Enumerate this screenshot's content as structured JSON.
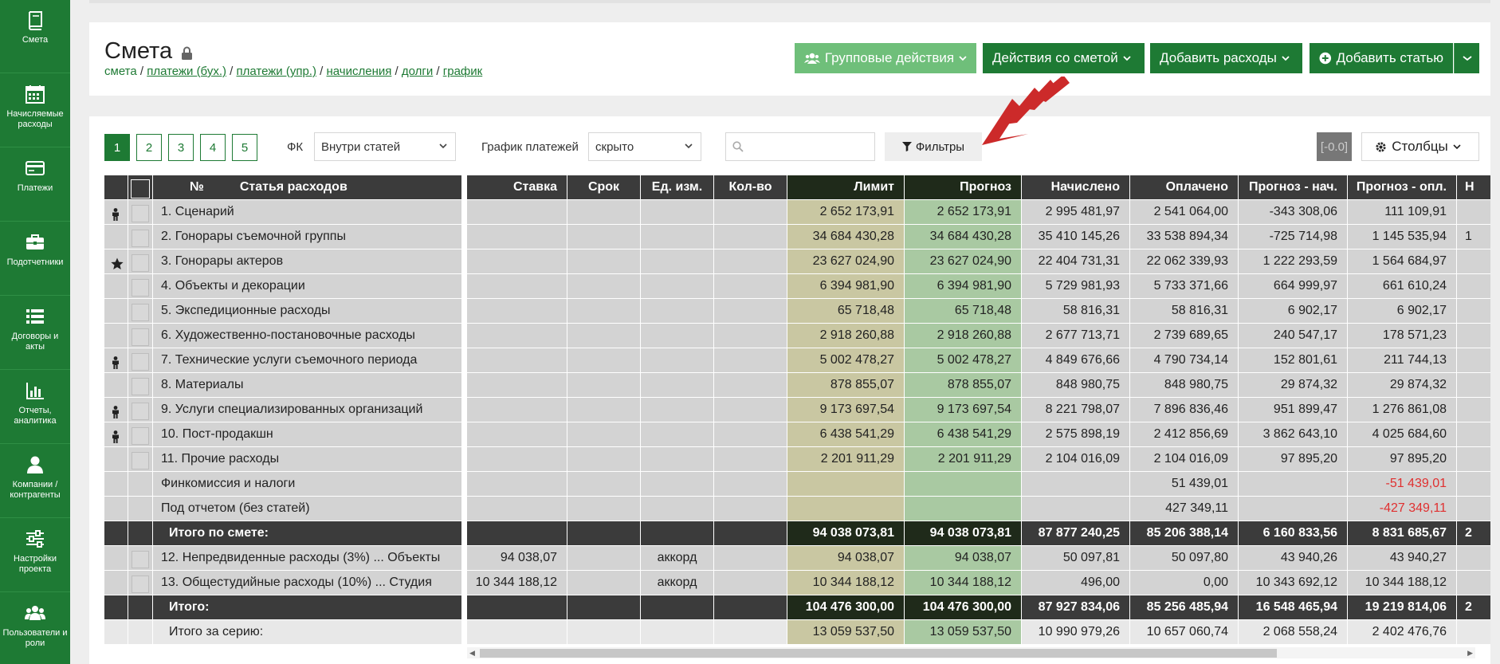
{
  "sidebar": {
    "items": [
      {
        "label": "Смета",
        "icon": "book-icon"
      },
      {
        "label": "Начисляемые расходы",
        "icon": "calendar-icon"
      },
      {
        "label": "Платежи",
        "icon": "credit-card-icon"
      },
      {
        "label": "Подотчетники",
        "icon": "briefcase-icon"
      },
      {
        "label": "Договоры и акты",
        "icon": "list-icon"
      },
      {
        "label": "Отчеты, аналитика",
        "icon": "bar-chart-icon"
      },
      {
        "label": "Компании / контрагенты",
        "icon": "user-icon"
      },
      {
        "label": "Настройки проекта",
        "icon": "sliders-icon"
      },
      {
        "label": "Пользователи и роли",
        "icon": "users-icon"
      }
    ]
  },
  "header": {
    "title": "Смета",
    "breadcrumb": {
      "current": "смета",
      "links": [
        "платежи (бух.)",
        "платежи (упр.)",
        "начисления",
        "долги",
        "график"
      ],
      "separator": " / "
    },
    "buttons": {
      "group_actions": "Групповые действия",
      "estimate_actions": "Действия со сметой",
      "add_expenses": "Добавить расходы",
      "add_item": "Добавить статью"
    }
  },
  "toolbar": {
    "pages": [
      "1",
      "2",
      "3",
      "4",
      "5"
    ],
    "fk_label": "ФК",
    "fk_value": "Внутри статей",
    "schedule_label": "График платежей",
    "schedule_value": "скрыто",
    "search_placeholder": "",
    "filters_label": "Фильтры",
    "counter": "[-0.0]",
    "columns_label": "Столбцы"
  },
  "table": {
    "headers": {
      "num": "№",
      "name": "Статья расходов",
      "rate": "Ставка",
      "term": "Срок",
      "unit": "Ед. изм.",
      "qty": "Кол-во",
      "limit": "Лимит",
      "forecast": "Прогноз",
      "accrued": "Начислено",
      "paid": "Оплачено",
      "fc_acc": "Прогноз - нач.",
      "fc_paid": "Прогноз - опл.",
      "extra": "Н"
    },
    "rows": [
      {
        "icon": "person-icon",
        "name": "1. Сценарий",
        "rate": "",
        "unit": "",
        "limit": "2 652 173,91",
        "forecast": "2 652 173,91",
        "accrued": "2 995 481,97",
        "paid": "2 541 064,00",
        "fc_acc": "-343 308,06",
        "fc_paid": "111 109,91",
        "extra": ""
      },
      {
        "icon": "",
        "name": "2. Гонорары съемочной группы",
        "rate": "",
        "unit": "",
        "limit": "34 684 430,28",
        "forecast": "34 684 430,28",
        "accrued": "35 410 145,26",
        "paid": "33 538 894,34",
        "fc_acc": "-725 714,98",
        "fc_paid": "1 145 535,94",
        "extra": "1"
      },
      {
        "icon": "star-icon",
        "name": "3. Гонорары актеров",
        "rate": "",
        "unit": "",
        "limit": "23 627 024,90",
        "forecast": "23 627 024,90",
        "accrued": "22 404 731,31",
        "paid": "22 062 339,93",
        "fc_acc": "1 222 293,59",
        "fc_paid": "1 564 684,97",
        "extra": ""
      },
      {
        "icon": "",
        "name": "4. Объекты и декорации",
        "rate": "",
        "unit": "",
        "limit": "6 394 981,90",
        "forecast": "6 394 981,90",
        "accrued": "5 729 981,93",
        "paid": "5 733 371,66",
        "fc_acc": "664 999,97",
        "fc_paid": "661 610,24",
        "extra": ""
      },
      {
        "icon": "",
        "name": "5. Экспедиционные расходы",
        "rate": "",
        "unit": "",
        "limit": "65 718,48",
        "forecast": "65 718,48",
        "accrued": "58 816,31",
        "paid": "58 816,31",
        "fc_acc": "6 902,17",
        "fc_paid": "6 902,17",
        "extra": ""
      },
      {
        "icon": "",
        "name": "6. Художественно-постановочные расходы",
        "rate": "",
        "unit": "",
        "limit": "2 918 260,88",
        "forecast": "2 918 260,88",
        "accrued": "2 677 713,71",
        "paid": "2 739 689,65",
        "fc_acc": "240 547,17",
        "fc_paid": "178 571,23",
        "extra": ""
      },
      {
        "icon": "person-icon",
        "name": "7. Технические услуги съемочного периода",
        "rate": "",
        "unit": "",
        "limit": "5 002 478,27",
        "forecast": "5 002 478,27",
        "accrued": "4 849 676,66",
        "paid": "4 790 734,14",
        "fc_acc": "152 801,61",
        "fc_paid": "211 744,13",
        "extra": ""
      },
      {
        "icon": "",
        "name": "8. Материалы",
        "rate": "",
        "unit": "",
        "limit": "878 855,07",
        "forecast": "878 855,07",
        "accrued": "848 980,75",
        "paid": "848 980,75",
        "fc_acc": "29 874,32",
        "fc_paid": "29 874,32",
        "extra": ""
      },
      {
        "icon": "person-icon",
        "name": "9. Услуги специализированных организаций",
        "rate": "",
        "unit": "",
        "limit": "9 173 697,54",
        "forecast": "9 173 697,54",
        "accrued": "8 221 798,07",
        "paid": "7 896 836,46",
        "fc_acc": "951 899,47",
        "fc_paid": "1 276 861,08",
        "extra": ""
      },
      {
        "icon": "person-icon",
        "name": "10. Пост-продакшн",
        "rate": "",
        "unit": "",
        "limit": "6 438 541,29",
        "forecast": "6 438 541,29",
        "accrued": "2 575 898,19",
        "paid": "2 412 856,69",
        "fc_acc": "3 862 643,10",
        "fc_paid": "4 025 684,60",
        "extra": ""
      },
      {
        "icon": "",
        "name": "11. Прочие расходы",
        "rate": "",
        "unit": "",
        "limit": "2 201 911,29",
        "forecast": "2 201 911,29",
        "accrued": "2 104 016,09",
        "paid": "2 104 016,09",
        "fc_acc": "97 895,20",
        "fc_paid": "97 895,20",
        "extra": ""
      }
    ],
    "special_rows": [
      {
        "name": "Финкомиссия и налоги",
        "paid": "51 439,01",
        "fc_paid": "-51 439,01"
      },
      {
        "name": "Под отчетом (без статей)",
        "paid": "427 349,11",
        "fc_paid": "-427 349,11"
      }
    ],
    "subtotal": {
      "name": "Итого по смете:",
      "limit": "94 038 073,81",
      "forecast": "94 038 073,81",
      "accrued": "87 877 240,25",
      "paid": "85 206 388,14",
      "fc_acc": "6 160 833,56",
      "fc_paid": "8 831 685,67",
      "extra": "2"
    },
    "extra_rows": [
      {
        "name": "12. Непредвиденные расходы (3%) ... Объекты",
        "rate": "94 038,07",
        "unit": "аккорд",
        "limit": "94 038,07",
        "forecast": "94 038,07",
        "accrued": "50 097,81",
        "paid": "50 097,80",
        "fc_acc": "43 940,26",
        "fc_paid": "43 940,27"
      },
      {
        "name": "13. Общестудийные расходы (10%) ... Студия",
        "rate": "10 344 188,12",
        "unit": "аккорд",
        "limit": "10 344 188,12",
        "forecast": "10 344 188,12",
        "accrued": "496,00",
        "paid": "0,00",
        "fc_acc": "10 343 692,12",
        "fc_paid": "10 344 188,12"
      }
    ],
    "total": {
      "name": "Итого:",
      "limit": "104 476 300,00",
      "forecast": "104 476 300,00",
      "accrued": "87 927 834,06",
      "paid": "85 256 485,94",
      "fc_acc": "16 548 465,94",
      "fc_paid": "19 219 814,06",
      "extra": "2"
    },
    "series": {
      "name": "Итого за серию:",
      "limit": "13 059 537,50",
      "forecast": "13 059 537,50",
      "accrued": "10 990 979,26",
      "paid": "10 657 060,74",
      "fc_acc": "2 068 558,24",
      "fc_paid": "2 402 476,76",
      "extra": ""
    }
  },
  "colors": {
    "brand": "#1e7a34",
    "brand_light": "#6fbf7a",
    "negative": "#e03030",
    "arrow": "#cc2a2a"
  }
}
